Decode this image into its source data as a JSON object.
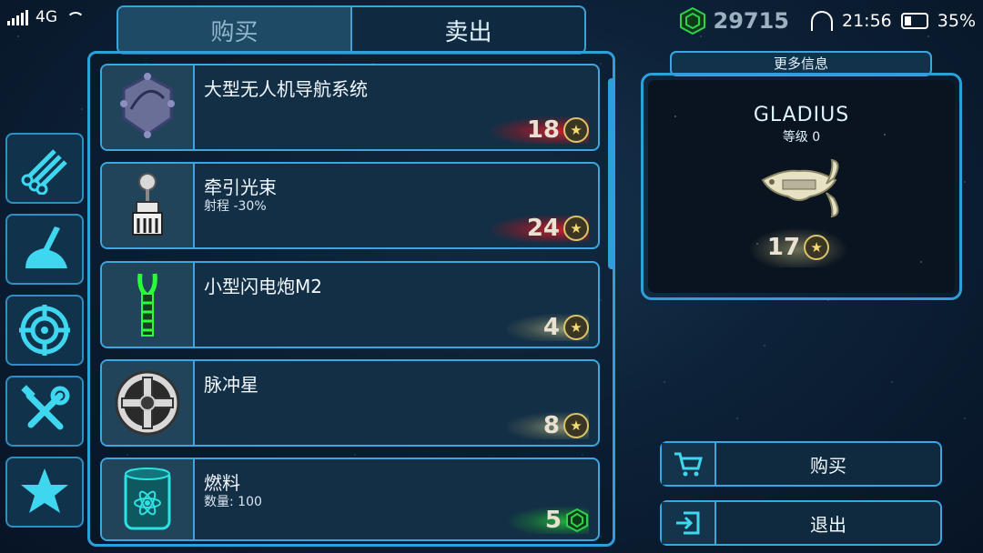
{
  "status": {
    "network": "4G",
    "credits": "29715",
    "time": "21:56",
    "battery": "35%",
    "battery_level": 0.35
  },
  "tabs": [
    {
      "label": "购买",
      "active": true
    },
    {
      "label": "卖出",
      "active": false
    }
  ],
  "categories": [
    {
      "icon": "pipes-icon"
    },
    {
      "icon": "claw-icon"
    },
    {
      "icon": "crosshair-icon"
    },
    {
      "icon": "tools-icon"
    },
    {
      "icon": "star-icon"
    }
  ],
  "items": [
    {
      "name": "大型无人机导航系统",
      "sub": "",
      "price": "18",
      "currency": "coin",
      "glow": "red",
      "icon": "drone-navigation-icon"
    },
    {
      "name": "牵引光束",
      "sub": "射程 -30%",
      "price": "24",
      "currency": "coin",
      "glow": "red",
      "icon": "tractor-beam-icon"
    },
    {
      "name": "小型闪电炮M2",
      "sub": "",
      "price": "4",
      "currency": "coin",
      "glow": "yellow",
      "icon": "lightning-cannon-icon"
    },
    {
      "name": "脉冲星",
      "sub": "",
      "price": "8",
      "currency": "coin",
      "glow": "yellow",
      "icon": "pulsar-icon"
    },
    {
      "name": "燃料",
      "sub": "数量: 100",
      "price": "5",
      "currency": "gem",
      "glow": "green",
      "icon": "fuel-barrel-icon"
    }
  ],
  "info": {
    "title": "更多信息",
    "ship_name": "GLADIUS",
    "ship_level": "等级 0",
    "ship_price": "17"
  },
  "actions": {
    "buy_label": "购买",
    "exit_label": "退出"
  },
  "colors": {
    "accent": "#3aa7e0",
    "price_red": "#d21e28",
    "price_green": "#28c83c",
    "coin_gold": "#d9c46a"
  }
}
